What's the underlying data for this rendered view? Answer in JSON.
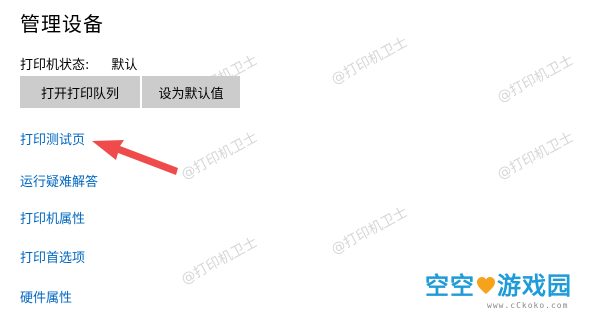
{
  "page": {
    "title": "管理设备"
  },
  "status": {
    "label": "打印机状态:",
    "value": "默认"
  },
  "buttons": {
    "open_queue": "打开打印队列",
    "set_default": "设为默认值"
  },
  "links": [
    "打印测试页",
    "运行疑难解答",
    "打印机属性",
    "打印首选项",
    "硬件属性"
  ],
  "watermark": {
    "text": "@打印机卫士"
  },
  "logo": {
    "part1": "空空",
    "part2": "游戏园",
    "sub": "www.cCkoko.com",
    "icon": "heart-icon"
  },
  "colors": {
    "link": "#0067c0",
    "button_bg": "#cccccc",
    "arrow": "#ef4b4b",
    "logo_blue": "#1f9bd8",
    "logo_heart": "#f7a21b"
  }
}
